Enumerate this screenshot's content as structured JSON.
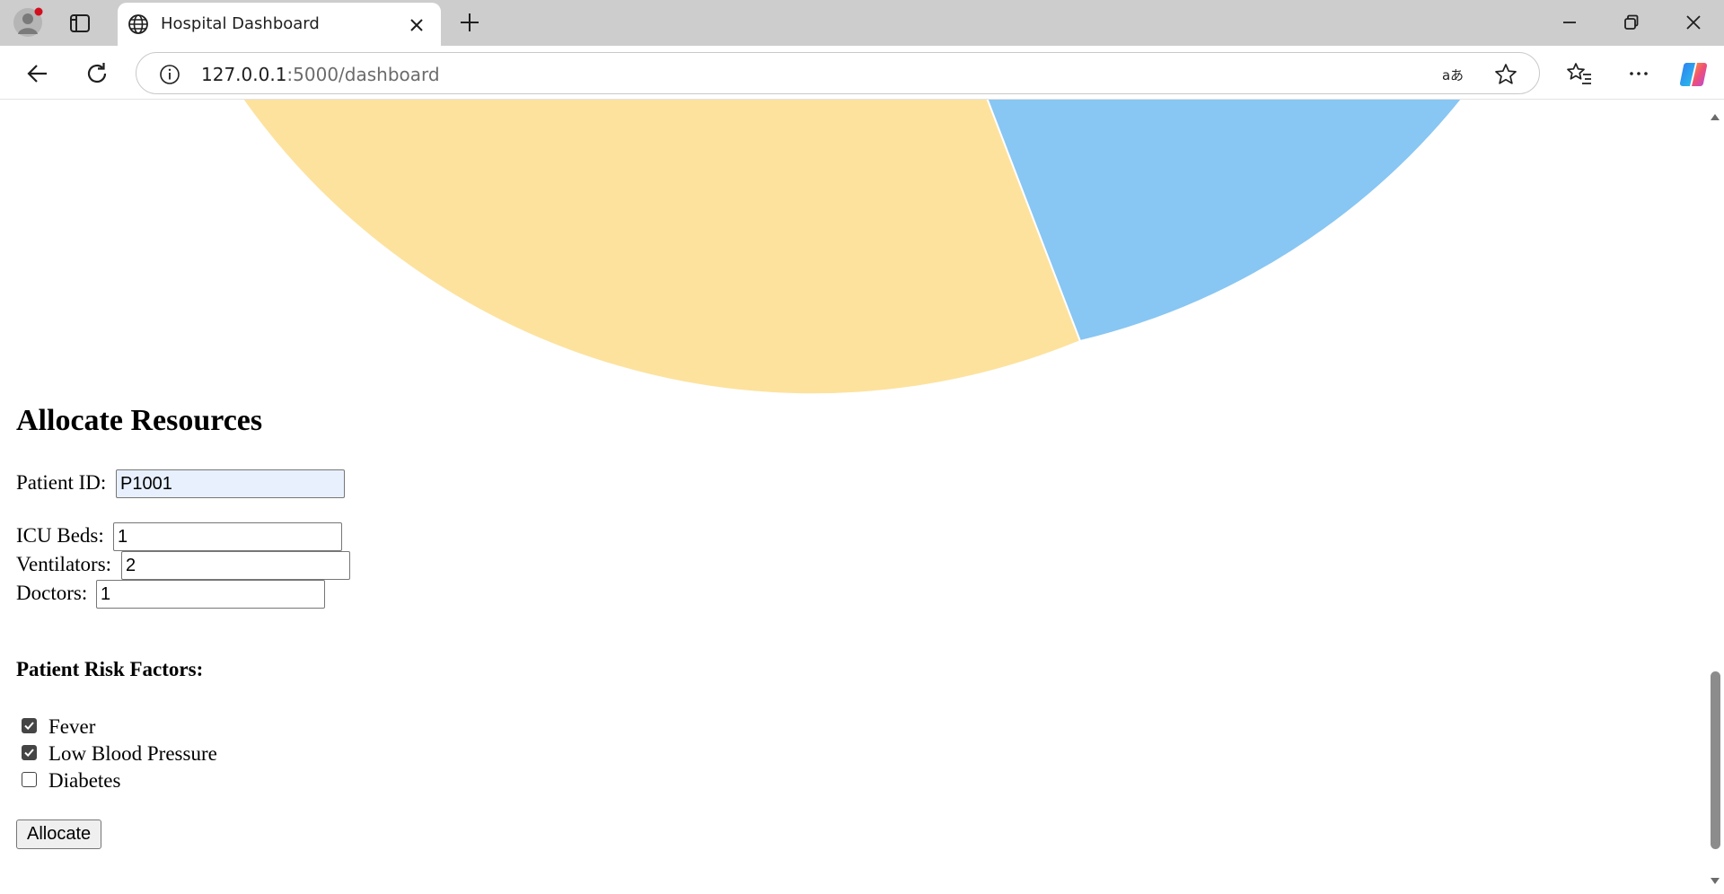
{
  "browser": {
    "tab_title": "Hospital Dashboard",
    "url_host": "127.0.0.1",
    "url_path": ":5000/dashboard",
    "icons": {
      "profile": "profile-avatar-icon",
      "tab_actions": "tab-actions-icon",
      "favicon": "globe-icon",
      "tab_close": "close-icon",
      "new_tab": "plus-icon",
      "minimize": "minimize-icon",
      "restore": "restore-icon",
      "close": "close-window-icon",
      "back": "back-arrow-icon",
      "refresh": "refresh-icon",
      "site_info": "info-icon",
      "read_aloud": "translate-icon",
      "favorite": "star-icon",
      "favorites": "favorites-list-icon",
      "more": "more-icon",
      "copilot": "copilot-icon"
    }
  },
  "colors": {
    "slice_yellow": "#fde29e",
    "slice_blue": "#88c6f3",
    "autofill_bg": "#e8f0fe"
  },
  "chart_data": {
    "type": "pie",
    "note_visible": "Bottom portion of pie only; labels scrolled out of view",
    "slices": [
      {
        "color": "#fde29e"
      },
      {
        "color": "#88c6f3"
      }
    ]
  },
  "form": {
    "title": "Allocate Resources",
    "patient_id_label": "Patient ID:",
    "patient_id_value": "P1001",
    "icu_beds_label": "ICU Beds:",
    "icu_beds_value": "1",
    "ventilators_label": "Ventilators:",
    "ventilators_value": "2",
    "doctors_label": "Doctors:",
    "doctors_value": "1",
    "risk_title": "Patient Risk Factors:",
    "risk_factors": [
      {
        "label": "Fever",
        "checked": true
      },
      {
        "label": "Low Blood Pressure",
        "checked": true
      },
      {
        "label": "Diabetes",
        "checked": false
      }
    ],
    "submit_label": "Allocate"
  }
}
